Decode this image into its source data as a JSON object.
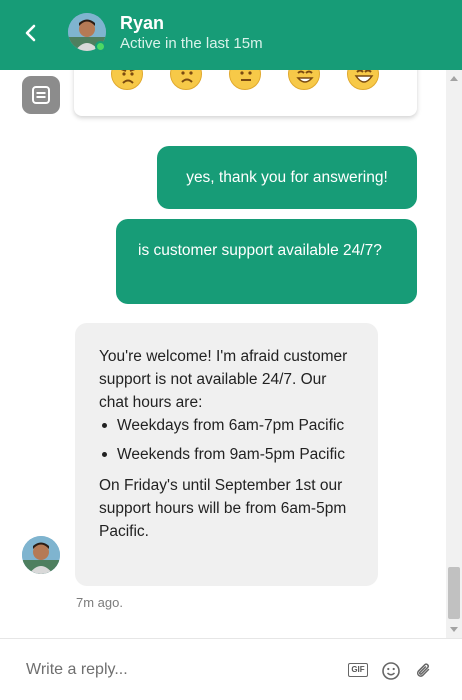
{
  "header": {
    "agent_name": "Ryan",
    "status": "Active in the last 15m"
  },
  "messages": {
    "user_1": "yes, thank you for answering!",
    "user_2": "is customer support available 24/7?",
    "agent_reply": {
      "intro": "You're welcome! I'm afraid customer support is not available 24/7. Our chat hours are:",
      "bullets": [
        "Weekdays from 6am-7pm Pacific",
        "Weekends from 9am-5pm Pacific"
      ],
      "outro": "On Friday's until September 1st our support hours will be from 6am-5pm Pacific."
    },
    "timestamp": "7m ago."
  },
  "composer": {
    "placeholder": "Write a reply...",
    "gif_label": "GIF"
  },
  "colors": {
    "brand": "#179c77",
    "agent_bubble": "#f0f0f0"
  },
  "icons": [
    "chevron-left-icon",
    "bot-icon",
    "gif-icon",
    "emoji-icon",
    "paperclip-icon"
  ]
}
